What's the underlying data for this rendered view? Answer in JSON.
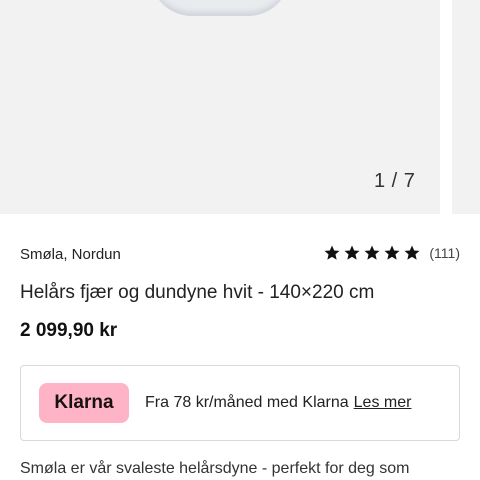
{
  "gallery": {
    "counter": "1 / 7"
  },
  "product": {
    "brand": "Smøla, Nordun",
    "rating_stars": 5,
    "rating_count": "(111)",
    "title": "Helårs fjær og dundyne hvit - 140×220 cm",
    "price": "2 099,90 kr"
  },
  "klarna": {
    "logo_text": "Klarna",
    "text": "Fra 78 kr/måned med Klarna",
    "link": "Les mer",
    "brand_color": "#ffb3c7"
  },
  "description": "Smøla er vår svaleste helårsdyne - perfekt for deg som"
}
